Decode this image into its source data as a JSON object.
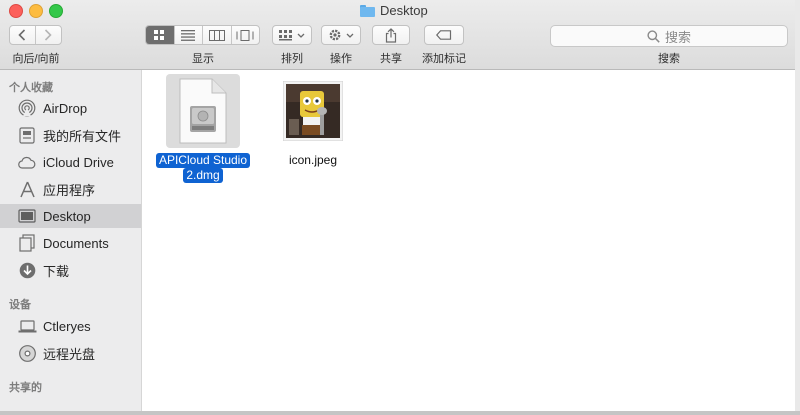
{
  "window": {
    "title": "Desktop"
  },
  "toolbar": {
    "nav_label": "向后/向前",
    "view_label": "显示",
    "arrange_label": "排列",
    "action_label": "操作",
    "share_label": "共享",
    "tags_label": "添加标记",
    "search_label": "搜索",
    "search_placeholder": "搜索"
  },
  "sidebar": {
    "favorites_header": "个人收藏",
    "devices_header": "设备",
    "shared_header": "共享的",
    "favorites": [
      {
        "label": "AirDrop",
        "icon": "airdrop-icon"
      },
      {
        "label": "我的所有文件",
        "icon": "all-files-icon"
      },
      {
        "label": "iCloud Drive",
        "icon": "cloud-icon"
      },
      {
        "label": "应用程序",
        "icon": "applications-icon"
      },
      {
        "label": "Desktop",
        "icon": "desktop-icon",
        "selected": true
      },
      {
        "label": "Documents",
        "icon": "documents-icon"
      },
      {
        "label": "下载",
        "icon": "download-icon"
      }
    ],
    "devices": [
      {
        "label": "Ctleryes",
        "icon": "laptop-icon"
      },
      {
        "label": "远程光盘",
        "icon": "disc-icon"
      }
    ]
  },
  "files": [
    {
      "name_line1": "APICloud Studio",
      "name_line2": "2.dmg",
      "icon": "dmg-file-icon",
      "selected": true
    },
    {
      "name": "icon.jpeg",
      "icon": "image-thumbnail"
    }
  ],
  "colors": {
    "selection": "#0f63d2",
    "sidebar_bg": "#ececed",
    "sidebar_selected": "#d1d1d3"
  }
}
